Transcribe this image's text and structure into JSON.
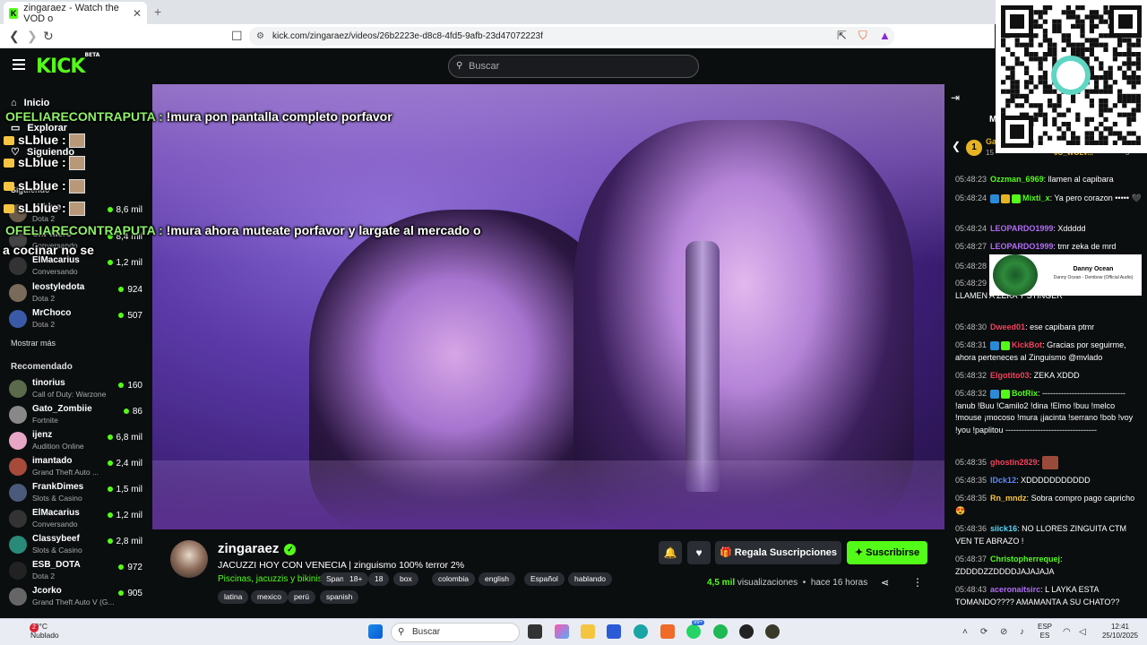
{
  "browser": {
    "tab_title": "zingaraez - Watch the VOD o",
    "tab_close": "✕",
    "new_tab": "+",
    "url": "kick.com/zingaraez/videos/26b2223e-d8c8-4fd5-9afb-23d47072223f"
  },
  "header": {
    "logo": "KICK",
    "logo_tag": "BETA",
    "search_placeholder": "Buscar"
  },
  "sidebar": {
    "nav": [
      {
        "label": "Inicio"
      },
      {
        "label": "Explorar"
      },
      {
        "label": "Siguiendo"
      }
    ],
    "following_title": "Siguiendo",
    "following": [
      {
        "name": "sLblue",
        "category": "Dota 2",
        "viewers": "8,6 mil",
        "color": "#6a5a4a"
      },
      {
        "name": "Sr.Phiero",
        "category": "Conversando",
        "viewers": "8,4 mil",
        "color": "#444"
      },
      {
        "name": "ElMacarius",
        "category": "Conversando",
        "viewers": "1,2 mil",
        "color": "#333"
      },
      {
        "name": "leostyledota",
        "category": "Dota 2",
        "viewers": "924",
        "color": "#7a6a5a"
      },
      {
        "name": "MrChoco",
        "category": "Dota 2",
        "viewers": "507",
        "color": "#3a5aa8"
      }
    ],
    "show_more": "Mostrar más",
    "recommended_title": "Recomendado",
    "recommended": [
      {
        "name": "tinorius",
        "category": "Call of Duty: Warzone",
        "viewers": "160",
        "color": "#5a6a4a"
      },
      {
        "name": "Gato_Zombiie",
        "category": "Fortnite",
        "viewers": "86",
        "color": "#888"
      },
      {
        "name": "ijenz",
        "category": "Audition Online",
        "viewers": "6,8 mil",
        "color": "#e8a6c6"
      },
      {
        "name": "imantado",
        "category": "Grand Theft Auto ...",
        "viewers": "2,4 mil",
        "color": "#a64a3a"
      },
      {
        "name": "FrankDimes",
        "category": "Slots & Casino",
        "viewers": "1,5 mil",
        "color": "#4a5a7a"
      },
      {
        "name": "ElMacarius",
        "category": "Conversando",
        "viewers": "1,2 mil",
        "color": "#333"
      },
      {
        "name": "Classybeef",
        "category": "Slots & Casino",
        "viewers": "2,8 mil",
        "color": "#2a8a7a"
      },
      {
        "name": "ESB_DOTA",
        "category": "Dota 2",
        "viewers": "972",
        "color": "#222"
      },
      {
        "name": "Jcorko",
        "category": "Grand Theft Auto V (G...",
        "viewers": "905",
        "color": "#666"
      }
    ]
  },
  "overlay": {
    "line1_name": "OFELIARECONTRAPUTA :",
    "line1_text": "!mura pon pantalla completo porfavor",
    "slblue_label": "sLblue :",
    "line2_name": "OFELIARECONTRAPUTA :",
    "line2_text": "!mura ahora muteate porfavor y largate al mercado o",
    "line3_text": "a cocinar no se"
  },
  "stream": {
    "channel": "zingaraez",
    "title": "JACUZZI HOY CON VENECIA | zinguismo 100% terror 2%",
    "category": "Piscinas, jacuzzis y bikinis",
    "tags_row1": [
      "Spanish",
      "18+",
      "18",
      "box",
      "colombia",
      "english",
      "Español",
      "hablando"
    ],
    "tags_row2": [
      "latina",
      "mexico",
      "perú",
      "spanish"
    ],
    "gift_label": "Regala Suscripciones",
    "subscribe_label": "Suscribirse",
    "views": "4,5 mil",
    "views_label": "visualizaciones",
    "age": "hace 16 horas"
  },
  "chat": {
    "pinned_user": "Ga",
    "pinned_rank": "1",
    "pinned_count": "15",
    "pinned_right": "0U_WOLV...",
    "pinned_right_count": "3",
    "header_initial": "M",
    "messages": [
      {
        "ts": "05:48:23",
        "user": "Ozzman_6969",
        "color": "#53fc18",
        "text": "llamen al capibara"
      },
      {
        "ts": "05:48:24",
        "user": "Mixti_x",
        "color": "#53fc18",
        "text": "Ya pero corazon ••••• 🖤"
      },
      {
        "ts": "05:48:24",
        "user": "LEOPARDO1999",
        "color": "#b06cf5",
        "text": "Xddddd"
      },
      {
        "ts": "05:48:27",
        "user": "LEOPARDO1999",
        "color": "#b06cf5",
        "text": "tmr zeka de mrd"
      },
      {
        "ts": "05:48:28",
        "user": "",
        "color": "#fff",
        "text": ""
      },
      {
        "ts": "05:48:29",
        "user": "",
        "color": "#fff",
        "text": "STINGER LLAMEN A ZEKA Y STINGER LLAMEN A ZEKA Y STINGER"
      },
      {
        "ts": "05:48:30",
        "user": "Dweed01",
        "color": "#f5405a",
        "text": "ese capibara ptmr"
      },
      {
        "ts": "05:48:31",
        "user": "KickBot",
        "color": "#f5405a",
        "text": "Gracias por seguirme, ahora perteneces al Zinguismo @mvlado"
      },
      {
        "ts": "05:48:32",
        "user": "Elgotito03",
        "color": "#f5405a",
        "text": "ZEKA XDDD"
      },
      {
        "ts": "05:48:32",
        "user": "BotRix",
        "color": "#53fc18",
        "text": "------------------------------- !anub !Buu !Camilo2 !dina !Elmo !buu !melco !mouse ¡mocoso !mura ¡jacinta !serrano !bob !voy !you !paplitou ----------------------------------"
      },
      {
        "ts": "05:48:35",
        "user": "ghostin2829",
        "color": "#f5405a",
        "text": ""
      },
      {
        "ts": "05:48:35",
        "user": "IDck12",
        "color": "#5a8af5",
        "text": "XDDDDDDDDDDD"
      },
      {
        "ts": "05:48:35",
        "user": "Rn_mndz",
        "color": "#f5c542",
        "text": "Sobra compro pago capricho 😍"
      },
      {
        "ts": "05:48:36",
        "user": "siick16",
        "color": "#5ad5f5",
        "text": "NO LLORES ZINGUITA CTM VEN TE ABRAZO !"
      },
      {
        "ts": "05:48:37",
        "user": "Christopherrequej",
        "color": "#53fc18",
        "text": "ZDDDDZZDDDDJAJAJAJA"
      },
      {
        "ts": "05:48:43",
        "user": "aceronaitsirc",
        "color": "#b06cf5",
        "text": "L LAYKA ESTA TOMANDO???? AMAMANTA A SU CHATO??"
      }
    ]
  },
  "spotify": {
    "artist": "Danny Ocean",
    "track": "Danny Ocean - Dembow (Official Audio)"
  },
  "taskbar": {
    "temp": "19°C",
    "weather": "Nublado",
    "weather_badge": "2",
    "search": "Buscar",
    "lang1": "ESP",
    "lang2": "ES",
    "time": "12:41",
    "date": "25/10/2025",
    "whatsapp_badge": "99+"
  },
  "colors": {
    "accent": "#53fc18",
    "bg": "#0b0e0f"
  }
}
